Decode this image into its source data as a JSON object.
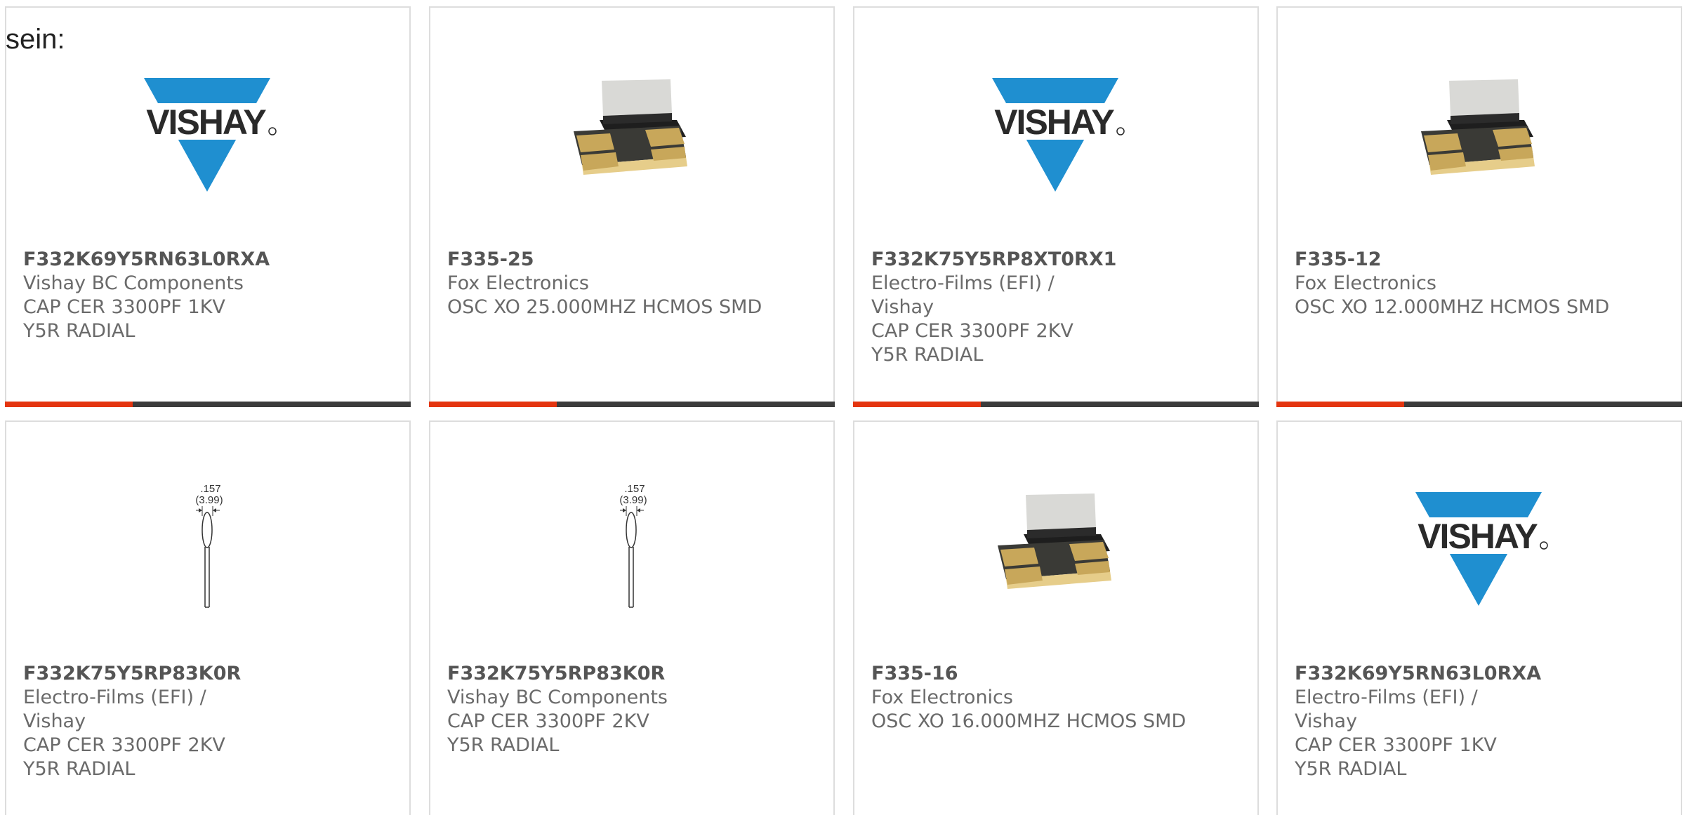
{
  "intro_text": "sein:",
  "colors": {
    "accent": "#e43510",
    "bar": "#3c3c3c",
    "vishay_blue": "#1f8fd0"
  },
  "products": [
    {
      "part_number": "F332K69Y5RN63L0RXA",
      "manufacturer": "Vishay BC Components",
      "description": "CAP CER 3300PF 1KV Y5R RADIAL",
      "image_icon": "vishay-logo-icon",
      "logo_text": "VISHAY"
    },
    {
      "part_number": "F335-25",
      "manufacturer": "Fox Electronics",
      "description": "OSC XO 25.000MHZ HCMOS SMD",
      "image_icon": "smd-oscillator-icon"
    },
    {
      "part_number": "F332K75Y5RP8XT0RX1",
      "manufacturer": "Electro-Films (EFI) / Vishay",
      "description": "CAP CER 3300PF 2KV Y5R RADIAL",
      "image_icon": "vishay-logo-icon",
      "logo_text": "VISHAY"
    },
    {
      "part_number": "F335-12",
      "manufacturer": "Fox Electronics",
      "description": "OSC XO 12.000MHZ HCMOS SMD",
      "image_icon": "smd-oscillator-icon"
    },
    {
      "part_number": "F332K75Y5RP83K0R",
      "manufacturer": "Electro-Films (EFI) / Vishay",
      "description": "CAP CER 3300PF 2KV Y5R RADIAL",
      "image_icon": "radial-capacitor-drawing-icon",
      "dim_inch": ".157",
      "dim_mm": "(3.99)"
    },
    {
      "part_number": "F332K75Y5RP83K0R",
      "manufacturer": "Vishay BC Components",
      "description": "CAP CER 3300PF 2KV Y5R RADIAL",
      "image_icon": "radial-capacitor-drawing-icon",
      "dim_inch": ".157",
      "dim_mm": "(3.99)"
    },
    {
      "part_number": "F335-16",
      "manufacturer": "Fox Electronics",
      "description": "OSC XO 16.000MHZ HCMOS SMD",
      "image_icon": "smd-oscillator-icon"
    },
    {
      "part_number": "F332K69Y5RN63L0RXA",
      "manufacturer": "Electro-Films (EFI) / Vishay",
      "description": "CAP CER 3300PF 1KV Y5R RADIAL",
      "image_icon": "vishay-logo-icon",
      "logo_text": "VISHAY"
    }
  ]
}
